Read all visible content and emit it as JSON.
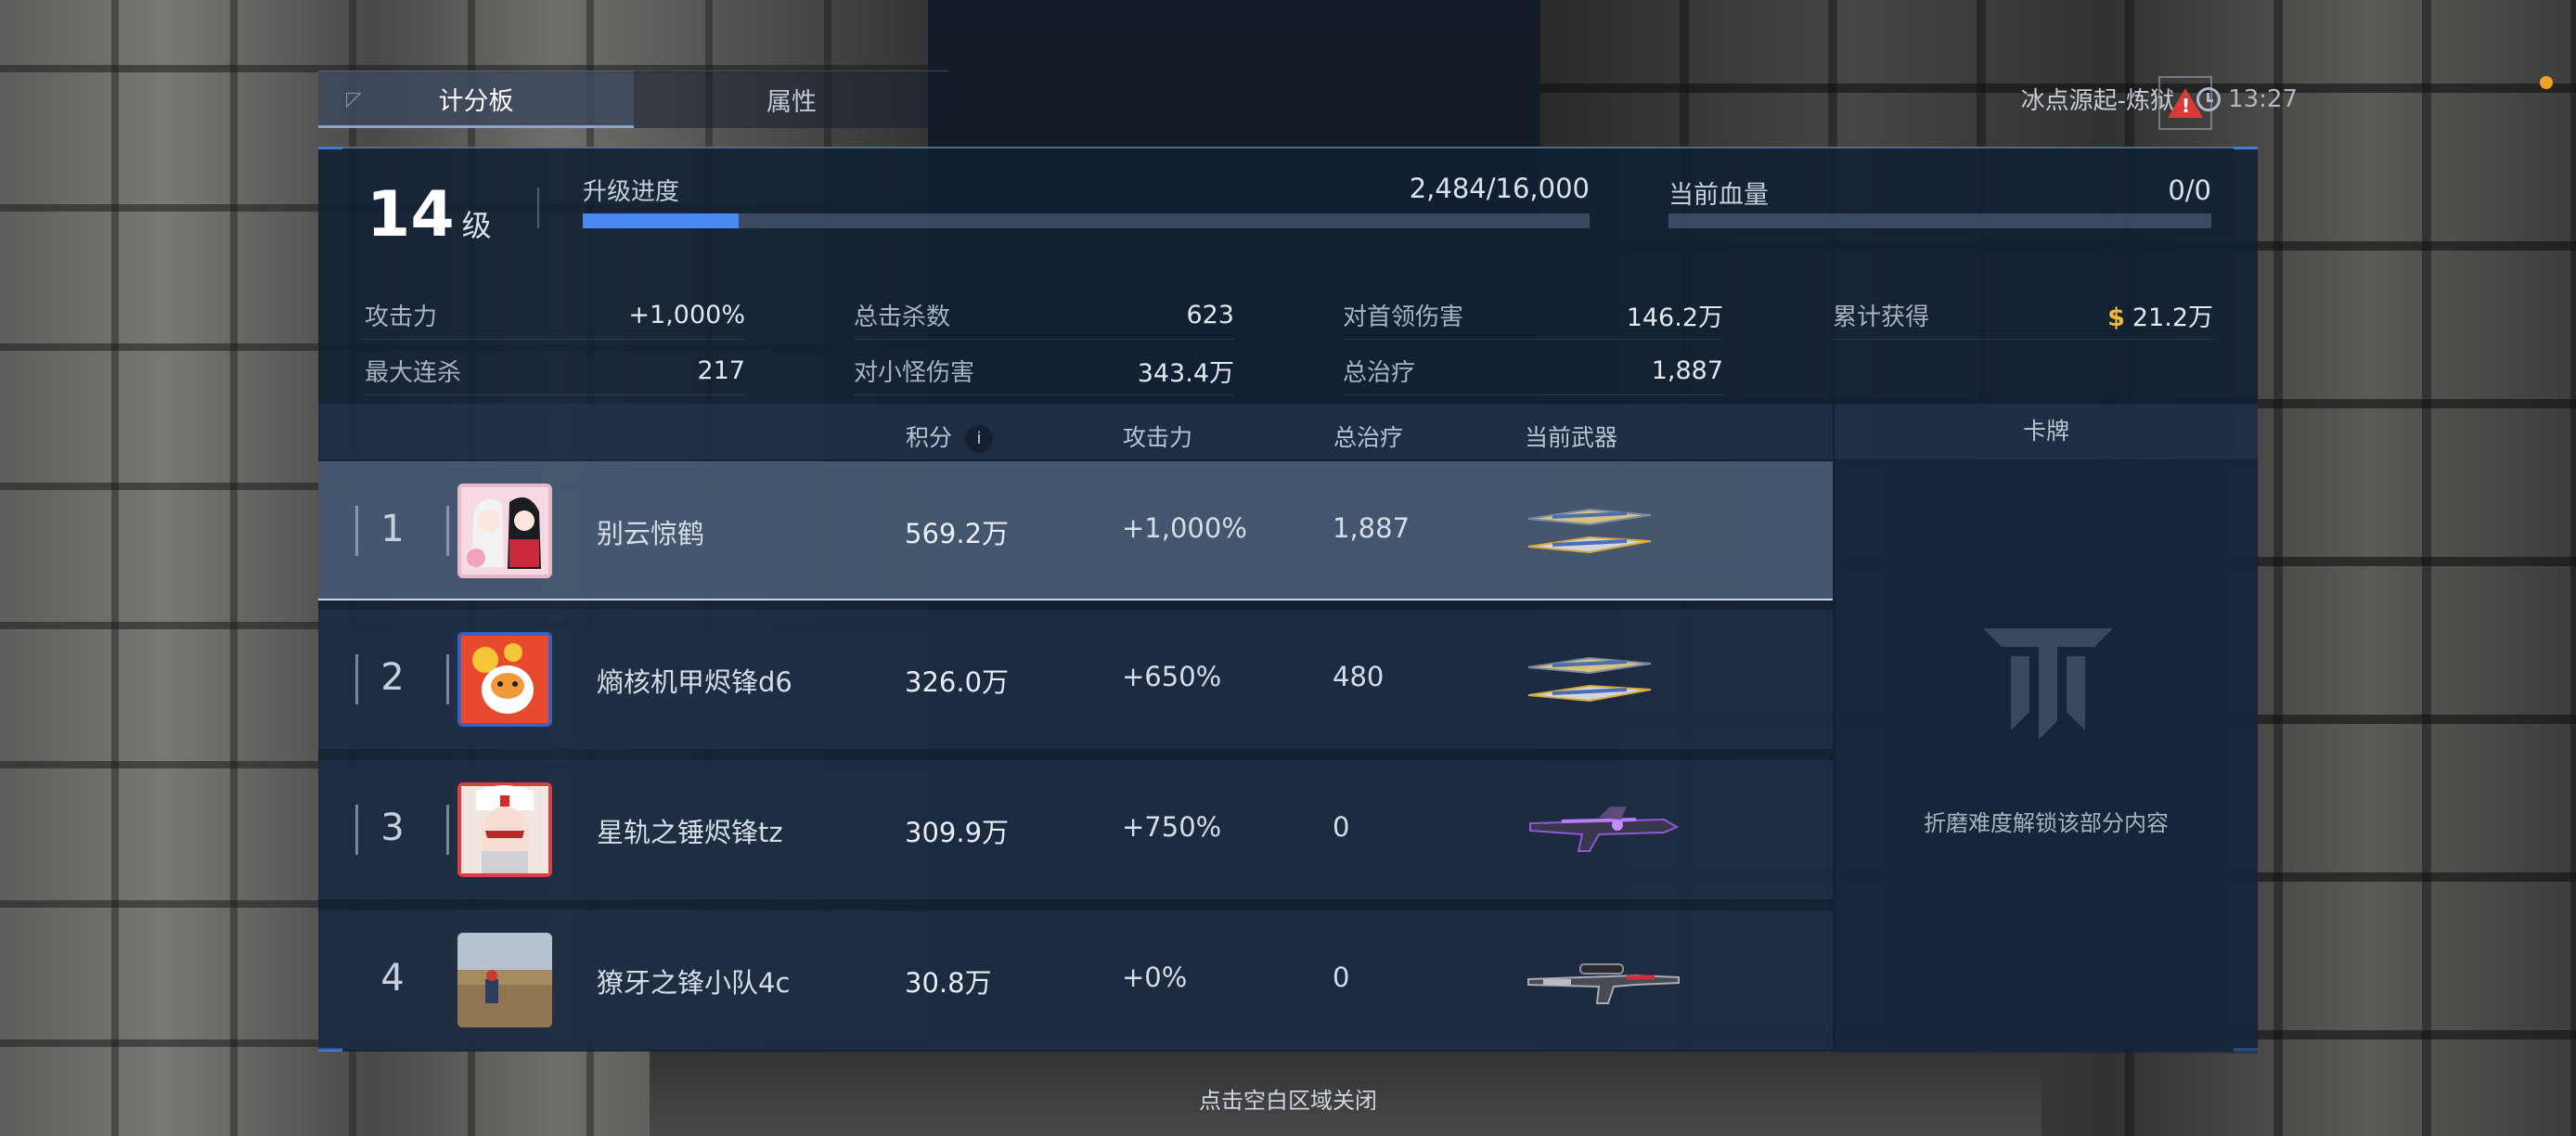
{
  "tabs": [
    {
      "label": "计分板",
      "active": true
    },
    {
      "label": "属性",
      "active": false
    }
  ],
  "hud": {
    "map_name": "冰点源起-炼狱",
    "time": "13:27"
  },
  "level": {
    "value": "14",
    "unit": "级",
    "xp_label": "升级进度",
    "xp_value": "2,484/16,000",
    "xp_fraction": 0.155,
    "hp_label": "当前血量",
    "hp_value": "0/0",
    "hp_fraction": 0
  },
  "stats": [
    {
      "key": "攻击力",
      "value": "+1,000%"
    },
    {
      "key": "总击杀数",
      "value": "623"
    },
    {
      "key": "对首领伤害",
      "value": "146.2万"
    },
    {
      "key": "累计获得",
      "value": "21.2万",
      "coin": "$"
    },
    {
      "key": "最大连杀",
      "value": "217"
    },
    {
      "key": "对小怪伤害",
      "value": "343.4万"
    },
    {
      "key": "总治疗",
      "value": "1,887"
    }
  ],
  "table": {
    "headers": {
      "score": "积分",
      "info": "i",
      "atk": "攻击力",
      "heal": "总治疗",
      "weapon": "当前武器",
      "card": "卡牌"
    },
    "rows": [
      {
        "rank": "1",
        "name": "别云惊鹤",
        "score": "569.2万",
        "atk": "+1,000%",
        "heal": "1,887",
        "weapon": "dual-blades",
        "me": true
      },
      {
        "rank": "2",
        "name": "熵核机甲烬锋d6",
        "score": "326.0万",
        "atk": "+650%",
        "heal": "480",
        "weapon": "dual-blades",
        "me": false
      },
      {
        "rank": "3",
        "name": "星轨之锤烬锋tz",
        "score": "309.9万",
        "atk": "+750%",
        "heal": "0",
        "weapon": "purple-rifle",
        "me": false
      },
      {
        "rank": "4",
        "name": "獠牙之锋小队4c",
        "score": "30.8万",
        "atk": "+0%",
        "heal": "0",
        "weapon": "sniper-rifle",
        "me": false
      }
    ]
  },
  "card": {
    "locked_text": "折磨难度解锁该部分内容"
  },
  "close_hint": "点击空白区域关闭",
  "colors": {
    "accent": "#4a8af0",
    "coin": "#f0b93a",
    "warning": "#d83a3a"
  }
}
